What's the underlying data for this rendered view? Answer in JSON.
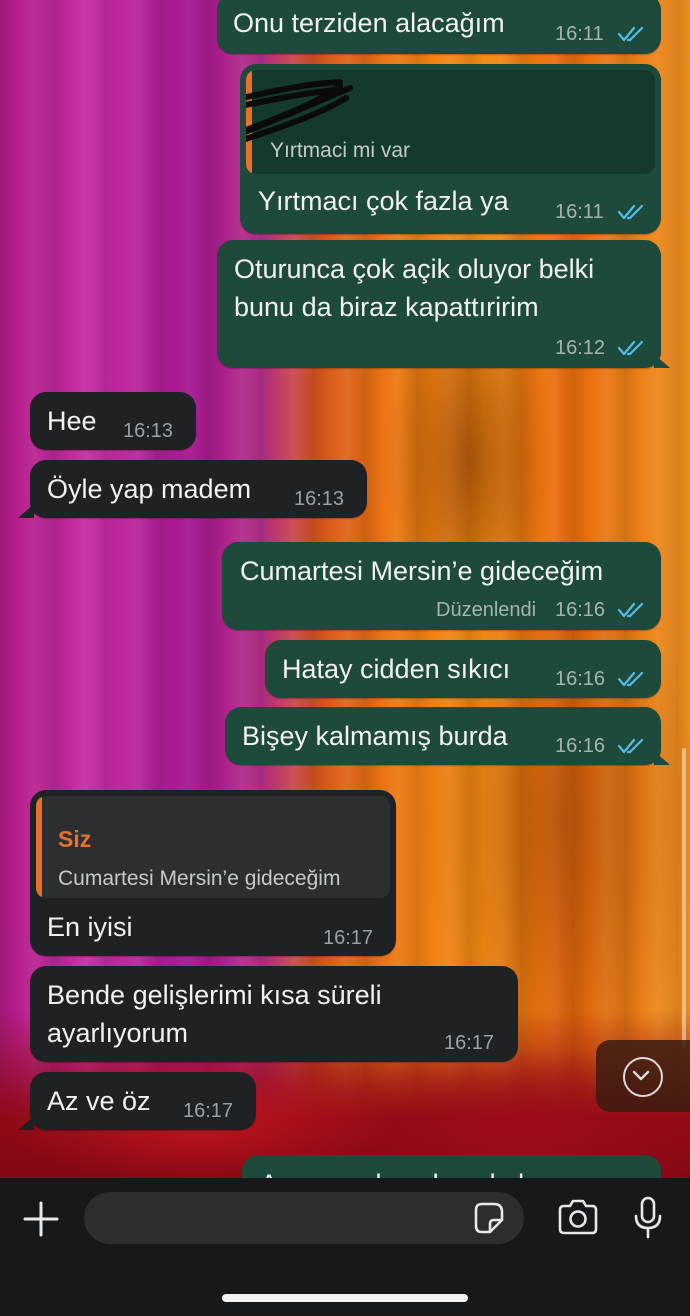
{
  "messages": {
    "m1": {
      "text": "Onu terziden alacağım",
      "time": "16:11"
    },
    "m2": {
      "quote_text": "Yırtmaci mi var",
      "text": "Yırtmacı çok fazla ya",
      "time": "16:11"
    },
    "m3": {
      "line1": "Oturunca çok açik oluyor belki",
      "line2": "bunu da biraz kapattıririm",
      "time": "16:12"
    },
    "m4": {
      "text": "Hee",
      "time": "16:13"
    },
    "m5": {
      "text": "Öyle yap madem",
      "time": "16:13"
    },
    "m6": {
      "text": "Cumartesi Mersin’e gideceğim",
      "edited": "Düzenlendi",
      "time": "16:16"
    },
    "m7": {
      "text": "Hatay cidden sıkıcı",
      "time": "16:16"
    },
    "m8": {
      "text": "Bişey kalmamış burda",
      "time": "16:16"
    },
    "m9": {
      "quote_author": "Siz",
      "quote_text": "Cumartesi Mersin’e gideceğim",
      "text": "En iyisi",
      "time": "16:17"
    },
    "m10": {
      "line1": "Bende gelişlerimi kısa süreli",
      "line2": "ayarlıyorum",
      "time": "16:17"
    },
    "m11": {
      "text": "Az ve öz",
      "time": "16:17"
    },
    "m12": {
      "text": "Ama sende çok az kalıyorsun"
    }
  },
  "icons": {
    "attach": "plus-icon",
    "sticker": "sticker-icon",
    "camera": "camera-icon",
    "mic": "microphone-icon",
    "scroll": "chevron-down-icon",
    "read": "double-check-icon"
  },
  "colors": {
    "outgoing_bubble": "#1d4a3a",
    "incoming_bubble": "#1f2224",
    "read_ticks": "#53bdeb",
    "quote_accent": "#e8702a"
  }
}
